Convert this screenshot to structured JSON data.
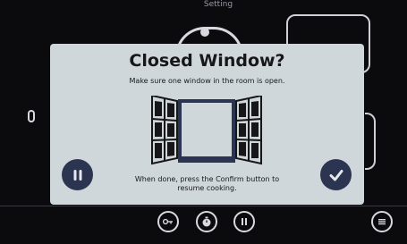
{
  "top_label": "Setting",
  "dialog": {
    "title": "Closed Window?",
    "subtitle": "Make sure one window in the room is open.",
    "instruction": "When done, press the Confirm button to resume cooking."
  },
  "icons": {
    "pause": "pause-icon",
    "confirm": "checkmark-icon",
    "key": "key-icon",
    "timer": "timer-icon",
    "menu": "menu-icon",
    "window": "open-window-illustration"
  },
  "colors": {
    "background": "#0b0b0e",
    "dialog_bg": "#cfd7db",
    "button": "#2b3450",
    "text": "#17171a"
  }
}
